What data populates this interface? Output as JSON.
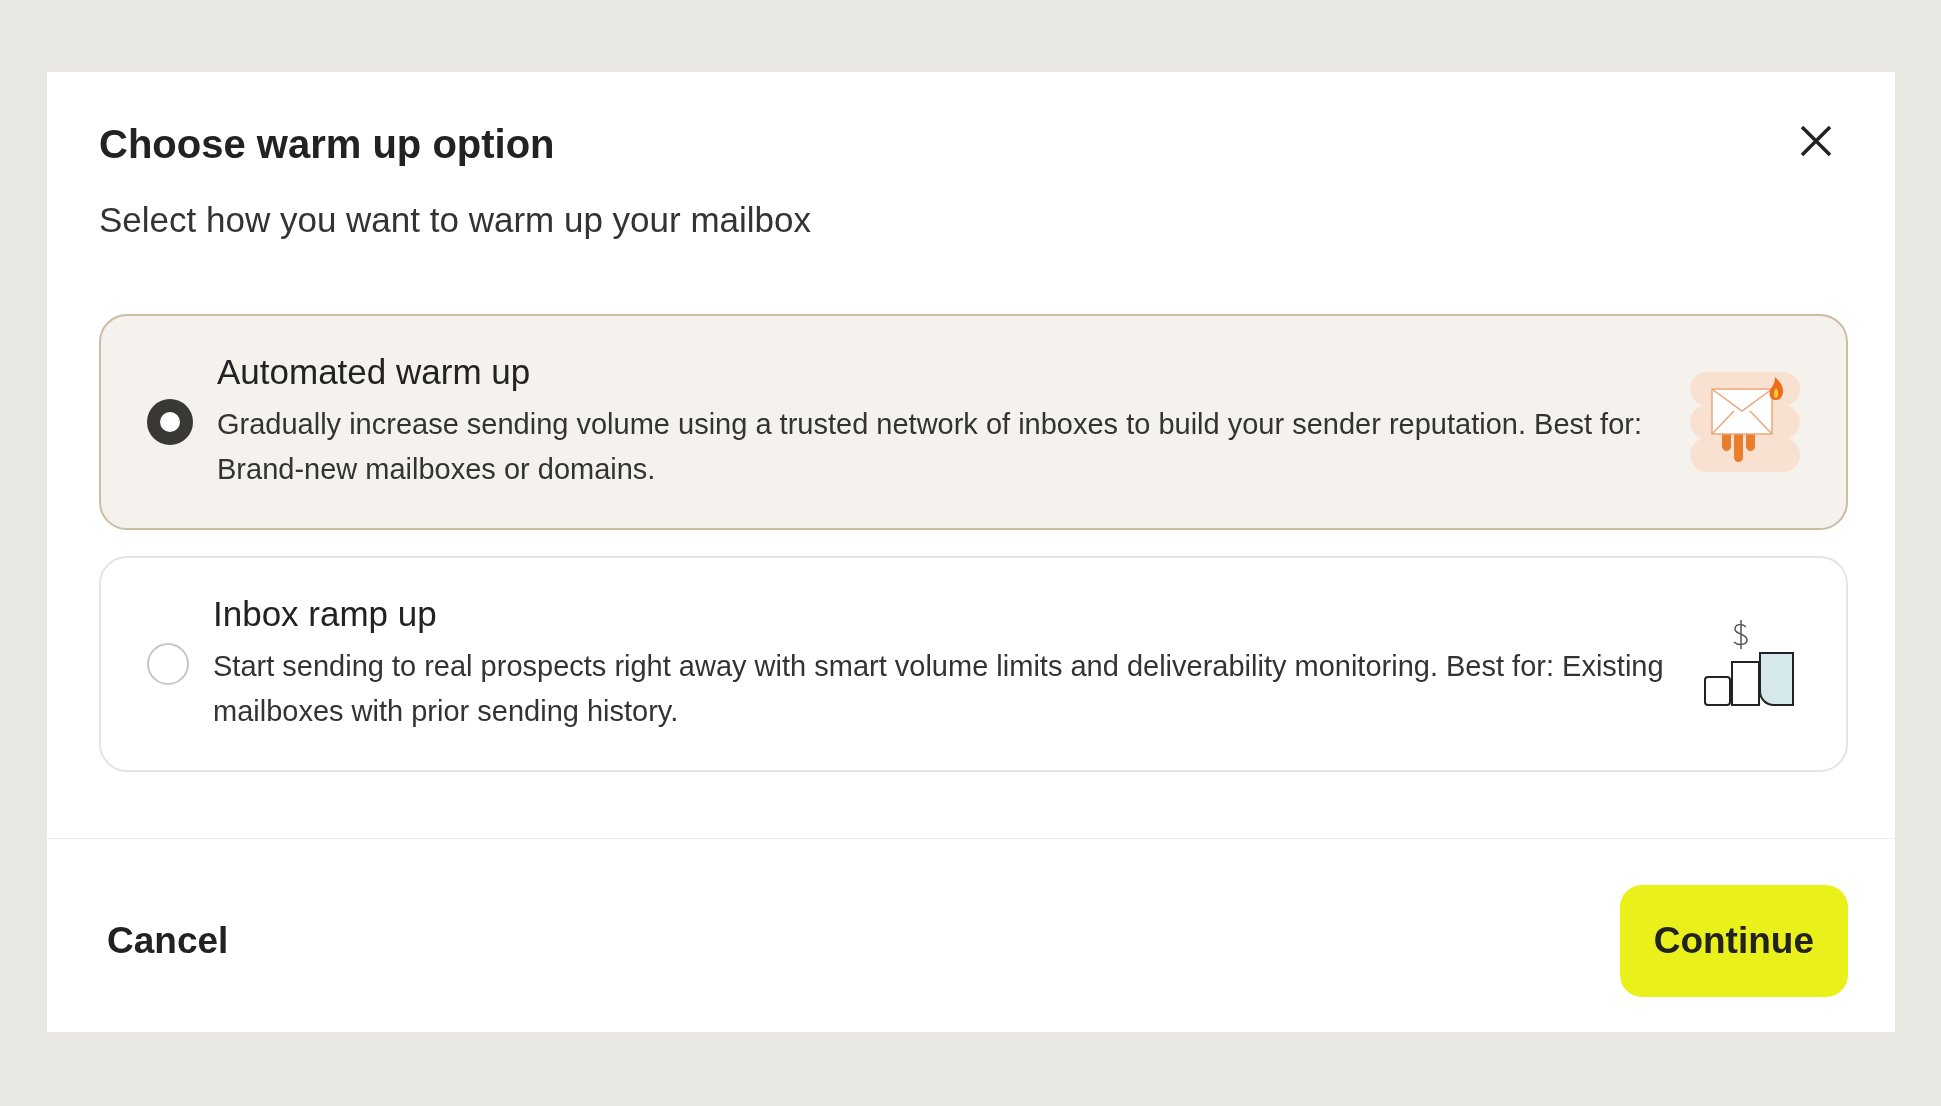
{
  "dialog": {
    "title": "Choose warm up option",
    "subtitle": "Select how you want to warm up your mailbox"
  },
  "options": [
    {
      "kind": "automated",
      "title": "Automated warm up",
      "description": "Gradually increase sending volume using a trusted network of inboxes to build your sender reputation. Best for: Brand-new mailboxes or domains.",
      "selected": true
    },
    {
      "kind": "ramp",
      "title": "Inbox ramp up",
      "description": "Start sending to real prospects right away with smart volume limits and deliverability monitoring. Best for: Existing mailboxes with prior sending history.",
      "selected": false
    }
  ],
  "buttons": {
    "cancel": "Cancel",
    "continue": "Continue"
  }
}
